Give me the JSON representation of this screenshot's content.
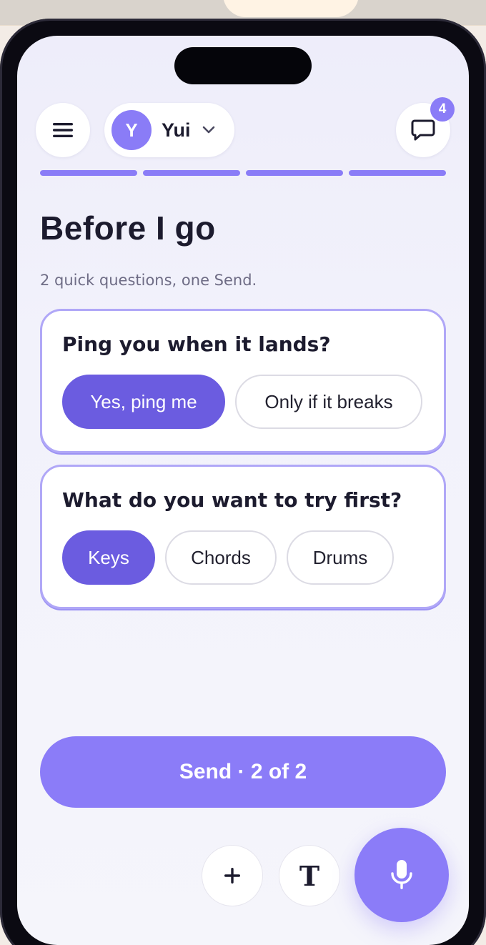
{
  "header": {
    "user": {
      "initial": "Y",
      "name": "Yui"
    },
    "messages_badge": "4",
    "progress_segments": 4
  },
  "page": {
    "title": "Before I go",
    "subtitle": "2 quick questions, one Send."
  },
  "questions": [
    {
      "prompt": "Ping you when it lands?",
      "options": [
        "Yes, ping me",
        "Only if it breaks"
      ],
      "selected": "Yes, ping me"
    },
    {
      "prompt": "What do you want to try first?",
      "options": [
        "Keys",
        "Chords",
        "Drums"
      ],
      "selected": "Keys"
    }
  ],
  "send_button": {
    "label": "Send · 2 of 2"
  },
  "toolbar": {
    "text_glyph": "T"
  },
  "icons": {
    "menu": "menu-icon",
    "chevron": "chevron-down-icon",
    "chat": "chat-bubble-icon",
    "plus": "plus-icon",
    "text": "text-format-icon",
    "mic": "microphone-icon"
  },
  "colors": {
    "accent": "#8b7cf8",
    "selected": "#6b5ce0",
    "text": "#1c1b2e"
  }
}
